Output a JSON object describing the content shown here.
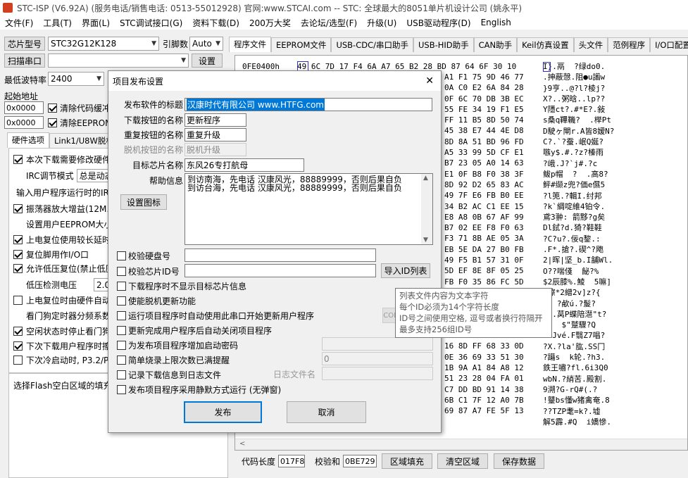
{
  "window": {
    "title": "STC-ISP (V6.92A) (服务电话/销售电话: 0513-55012928) 官网:www.STCAI.com  -- STC: 全球最大的8051单片机设计公司 (姚永平)"
  },
  "menu": [
    "文件(F)",
    "工具(T)",
    "界面(L)",
    "STC调试接口(G)",
    "资料下载(D)",
    "200万大奖",
    "去论坛/选型(F)",
    "升级(U)",
    "USB驱动程序(D)",
    "English"
  ],
  "left": {
    "chip_btn": "芯片型号",
    "chip_value": "STC32G12K128",
    "pins_label": "引脚数",
    "pins_value": "Auto",
    "scan_btn": "扫描串口",
    "settings_btn": "设置",
    "baud_label": "最低波特率",
    "baud_value": "2400",
    "start_addr_label": "起始地址",
    "addr1": "0x0000",
    "clear_code": "清除代码缓冲",
    "addr2": "0x0000",
    "clear_eeprom": "清除EEPROM缓冲",
    "tabs": [
      "硬件选项",
      "Link1/U8W脱机"
    ],
    "options": [
      {
        "label": "本次下载需要修改硬件",
        "checked": true
      },
      {
        "label": "IRC调节模式",
        "checked": null,
        "extra": "总是动态"
      },
      {
        "label": "输入用户程序运行时的IR",
        "checked": null
      },
      {
        "label": "振荡器放大增益(12M以",
        "checked": true
      },
      {
        "label": "设置用户EEPROM大小",
        "checked": null
      },
      {
        "label": "上电复位使用较长延时",
        "checked": true
      },
      {
        "label": "复位脚用作I/O口",
        "checked": true
      },
      {
        "label": "允许低压复位(禁止低压",
        "checked": true
      },
      {
        "label": "低压检测电压",
        "checked": null,
        "extra": "2.00"
      },
      {
        "label": "上电复位时由硬件自动",
        "checked": false
      },
      {
        "label": "看门狗定时器分频系数",
        "checked": null
      },
      {
        "label": "空闲状态时停止看门狗",
        "checked": true
      },
      {
        "label": "下次下载用户程序时擦",
        "checked": true
      },
      {
        "label": "下次冷启动时, P3.2/P3",
        "checked": false
      }
    ],
    "flash_fill": "选择Flash空白区域的填充"
  },
  "right": {
    "tabs": [
      "程序文件",
      "EEPROM文件",
      "USB-CDC/串口助手",
      "USB-HID助手",
      "CAN助手",
      "Keil仿真设置",
      "头文件",
      "范例程序",
      "I/O口配置工具"
    ],
    "first_line_addr": "0FE0400h",
    "hex_rows": [
      "49 6C 7D 17 F4 6A A7 65 B2 28 BD 87 64 6F 30 10",
      "",
      "",
      "",
      "",
      "",
      "",
      "",
      "",
      "",
      "",
      "",
      "",
      "",
      "",
      "",
      "",
      "",
      "",
      "",
      "",
      "",
      "",
      "",
      "",
      "",
      "",
      ""
    ],
    "hex_right": [
      "BD 87 64 6F 30 10",
      "A1 F1 75 9D 46 77",
      "0A C0 E2 6A 84 28",
      "0F 6C 70 DB 3B EC",
      "55 FE 34 19 F1 E5",
      "FF 11 B5 8D 50 74",
      "45 38 E7 44 4E D8",
      "8D 8A 51 BD 96 FD",
      "A5 33 99 5D CF E1",
      "B7 23 05 A0 14 63",
      "E1 0F B8 F0 38 3F",
      "8D 92 D2 65 83 AC",
      "49 7F E6 FB B0 EE",
      "34 B2 AC C1 EE 15",
      "E8 A8 0B 67 AF 99",
      "B7 02 EE F8 F0 63",
      "F3 71 8B AE 05 3A",
      "EB 5E DA 27 B0 FB",
      "49 F5 B1 57 31 0F",
      "5D EF 8E 8F 05 25",
      "FB F0 35 86 FC 5D",
      "",
      "",
      "",
      "",
      "D1 2E 53 53 FE 53",
      "16 8D FF 68 33 0D",
      "0E 36 69 33 51 30",
      "1B 9A A1 84 A8 12",
      "51 23 28 04 FA 01",
      "C7 DD BD 91 14 38",
      "6B C1 7F 12 A0 7B",
      "69 87 A7 FE 5F 13"
    ],
    "ascii_rows": [
      "I}.鬲  ?绿do0.",
      ".抻蔽愨.阻●u譾w",
      "}9亨..@?l?棱j?",
      "X?..粥晗..lp??",
      "Y隱ct?.#*E?.敍",
      "s桑q鞸鞿?  .榉Pt",
      "D駛ヶ閘r.A皆8嫒N?",
      "C?.`?蚕.岷Q娫?",
      "嗾y$.#.?z?榛雨",
      "?峨.J?`j#.?c",
      "鲅p帽  ?  .高8?",
      "鲆#缬z兜?価e儑5",
      "?l篼.?輯I.纣邦",
      "?k`綢啶維4铂令.",
      "鳶3翀: 箭黟?g矣",
      "Dl鉽?d.猗?鞋鞋",
      "?C?u?.佞q錅.:",
      ".F*.搶?.碶^?飑",
      "2|晖|坚_b.I舗Wl.",
      "O??喘俴  飶?%",
      "$2辰膝%.鯪  5嘛]",
      "?檫*2繒2v]z?{",
      "n  ?欳ú.?髲?",
      "?G.莴P蝶陪潖\"t?",
      "3?  $\"蹵驟?Q",
      "+8Jvé.F翳Z7唱?",
      "?X.?la'肱.SS冂",
      "?躤s  k轮.?h3.",
      "鉄王嘯?fl.6i3Q0",
      "wbN.?綃苦.殿割.",
      "9溯?G-rQ#(.?",
      "!鼞bs懂w猪禽奄.8",
      "??TZP耄=k?.墟",
      "解5霹.#Q  i嬌慘."
    ],
    "code_len_label": "代码长度",
    "code_len": "017F8",
    "checksum_label": "校验和",
    "checksum": "0BE729",
    "fill_btn": "区域填充",
    "clear_btn": "清空区域",
    "save_btn": "保存数据"
  },
  "dialog": {
    "title": "项目发布设置",
    "fields": [
      {
        "label": "发布软件的标题",
        "value": "汉康时代有限公司 www.HTFG.com",
        "selected": true
      },
      {
        "label": "下载按钮的名称",
        "value": "更新程序"
      },
      {
        "label": "重复按钮的名称",
        "value": "重复升级"
      },
      {
        "label": "脱机按钮的名称",
        "value": "脱机升级",
        "disabled": true
      },
      {
        "label": "目标芯片名称",
        "value": "东风26专打航母"
      }
    ],
    "help_label": "帮助信息",
    "help_lines": [
      "到访南海，先电话 汉康风光，88889999，否则后果自负",
      "到访台海，先电话 汉康风光，88889999，否则后果自负"
    ],
    "icon_btn": "设置图标",
    "checks": [
      {
        "label": "校验硬盘号",
        "checked": false
      },
      {
        "label": "校验芯片ID号",
        "checked": false
      },
      {
        "label": "下载程序时不显示目标芯片信息",
        "checked": false
      },
      {
        "label": "使能脱机更新功能",
        "checked": false
      },
      {
        "label": "运行项目程序时自动使用此串口开始更新用户程序",
        "checked": false
      },
      {
        "label": "更新完成用户程序后自动关闭项目程序",
        "checked": false
      },
      {
        "label": "为发布项目程序增加启动密码",
        "checked": false
      },
      {
        "label": "简单烧录上限次数已满提醒",
        "checked": false
      },
      {
        "label": "记录下载信息到日志文件",
        "checked": false
      },
      {
        "label": "发布项目程序采用静默方式运行 (无弹窗)",
        "checked": false
      }
    ],
    "import_btn": "导入ID列表",
    "com_label": "COM",
    "limit_value": "0",
    "log_label": "日志文件名",
    "publish_btn": "发布",
    "cancel_btn": "取消",
    "close": "✕"
  },
  "tooltip": [
    "列表文件内容为文本字符",
    "每个ID必须为14个字符长度",
    "ID号之间使用空格, 逗号或者换行符隔开",
    "最多支持256组ID号"
  ]
}
